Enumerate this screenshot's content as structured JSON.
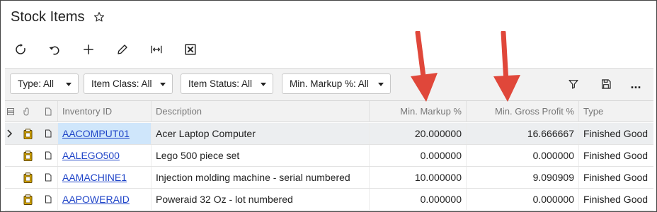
{
  "page": {
    "title": "Stock Items",
    "favorite_icon": "star-outline-icon"
  },
  "toolbar": {
    "buttons": [
      {
        "name": "refresh-button",
        "icon": "refresh-icon"
      },
      {
        "name": "undo-button",
        "icon": "undo-icon"
      },
      {
        "name": "add-button",
        "icon": "plus-icon"
      },
      {
        "name": "edit-button",
        "icon": "pencil-icon"
      },
      {
        "name": "fit-to-screen-button",
        "icon": "fit-width-icon"
      },
      {
        "name": "export-excel-button",
        "icon": "excel-icon"
      }
    ]
  },
  "filters": {
    "type": "Type: All",
    "item_class": "Item Class: All",
    "item_status": "Item Status: All",
    "min_markup": "Min. Markup %: All",
    "filter_icon": "funnel-icon",
    "save_icon": "save-icon",
    "more_label": "..."
  },
  "grid": {
    "columns": {
      "inventory_id": "Inventory ID",
      "description": "Description",
      "min_markup": "Min. Markup %",
      "min_gross_profit": "Min. Gross Profit %",
      "type": "Type"
    },
    "rows": [
      {
        "inventory_id": "AACOMPUT01",
        "description": "Acer Laptop Computer",
        "min_markup": "20.000000",
        "min_gross_profit": "16.666667",
        "type": "Finished Good"
      },
      {
        "inventory_id": "AALEGO500",
        "description": "Lego 500 piece set",
        "min_markup": "0.000000",
        "min_gross_profit": "0.000000",
        "type": "Finished Good"
      },
      {
        "inventory_id": "AAMACHINE1",
        "description": "Injection molding machine - serial numbered",
        "min_markup": "10.000000",
        "min_gross_profit": "9.090909",
        "type": "Finished Good"
      },
      {
        "inventory_id": "AAPOWERAID",
        "description": "Poweraid 32 Oz - lot numbered",
        "min_markup": "0.000000",
        "min_gross_profit": "0.000000",
        "type": "Finished Good"
      }
    ]
  },
  "colors": {
    "annotation_arrow": "#e0473a",
    "link": "#1f44c8",
    "clipboard_icon": "#c79a00"
  }
}
